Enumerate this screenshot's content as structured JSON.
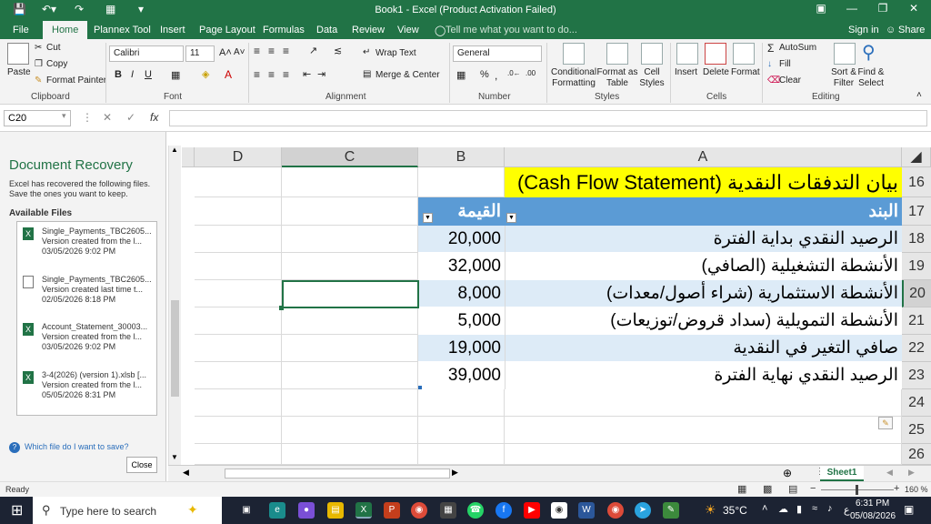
{
  "window": {
    "title": "Book1 - Excel (Product Activation Failed)",
    "signin": "Sign in",
    "share": "Share"
  },
  "tabs": [
    "File",
    "Home",
    "Plannex Tool",
    "Insert",
    "Page Layout",
    "Formulas",
    "Data",
    "Review",
    "View"
  ],
  "tell_me": "Tell me what you want to do...",
  "ribbon": {
    "clipboard": {
      "paste": "Paste",
      "cut": "Cut",
      "copy": "Copy",
      "format_painter": "Format Painter",
      "label": "Clipboard"
    },
    "font": {
      "name": "Calibri",
      "size": "11",
      "label": "Font"
    },
    "alignment": {
      "wrap": "Wrap Text",
      "merge": "Merge & Center",
      "label": "Alignment"
    },
    "number": {
      "format": "General",
      "label": "Number"
    },
    "styles": {
      "cond": "Conditional Formatting",
      "table": "Format as Table",
      "cell": "Cell Styles",
      "label": "Styles"
    },
    "cells": {
      "insert": "Insert",
      "delete": "Delete",
      "format": "Format",
      "label": "Cells"
    },
    "editing": {
      "autosum": "AutoSum",
      "fill": "Fill",
      "clear": "Clear",
      "sort": "Sort & Filter",
      "find": "Find & Select",
      "label": "Editing"
    }
  },
  "formula_bar": {
    "name_box": "C20",
    "formula": ""
  },
  "recovery": {
    "title": "Document Recovery",
    "description": "Excel has recovered the following files. Save the ones you want to keep.",
    "available": "Available Files",
    "files": [
      {
        "name": "Single_Payments_TBC2605...",
        "line2": "Version created from the l...",
        "line3": "03/05/2026 9:02 PM",
        "icon": "excel-icon"
      },
      {
        "name": "Single_Payments_TBC2605...",
        "line2": "Version created last time t...",
        "line3": "02/05/2026 8:18 PM",
        "icon": "file-icon"
      },
      {
        "name": "Account_Statement_30003...",
        "line2": "Version created from the l...",
        "line3": "03/05/2026 9:02 PM",
        "icon": "excel-icon"
      },
      {
        "name": "3-4(2026) (version 1).xlsb [...",
        "line2": "Version created from the l...",
        "line3": "05/05/2026 8:31 PM",
        "icon": "excel-icon"
      }
    ],
    "help": "Which file do I want to save?",
    "close": "Close"
  },
  "sheet": {
    "columns": [
      "A",
      "B",
      "C",
      "D"
    ],
    "rows": [
      "16",
      "17",
      "18",
      "19",
      "20",
      "21",
      "22",
      "23",
      "24",
      "25",
      "26"
    ],
    "title": "بيان التدفقات النقدية (Cash Flow Statement)",
    "header_item": "البند",
    "header_value": "القيمة",
    "data": [
      {
        "item": "الرصيد النقدي بداية الفترة",
        "value": "20,000"
      },
      {
        "item": "الأنشطة التشغيلية (الصافي)",
        "value": "32,000"
      },
      {
        "item": "الأنشطة الاستثمارية (شراء أصول/معدات)",
        "value": "8,000"
      },
      {
        "item": "الأنشطة التمويلية (سداد قروض/توزيعات)",
        "value": "5,000"
      },
      {
        "item": "صافي التغير في النقدية",
        "value": "19,000"
      },
      {
        "item": "الرصيد النقدي نهاية الفترة",
        "value": "39,000"
      }
    ],
    "tab": "Sheet1",
    "colors": {
      "header": "#5b9bd5",
      "band": "#ddebf7",
      "title_bg": "#ffff00"
    }
  },
  "status": {
    "ready": "Ready",
    "zoom": "160 %"
  },
  "taskbar": {
    "search": "Type here to search",
    "weather": "35°C",
    "lang": "ع",
    "time": "6:31 PM",
    "date": "05/08/2026"
  }
}
